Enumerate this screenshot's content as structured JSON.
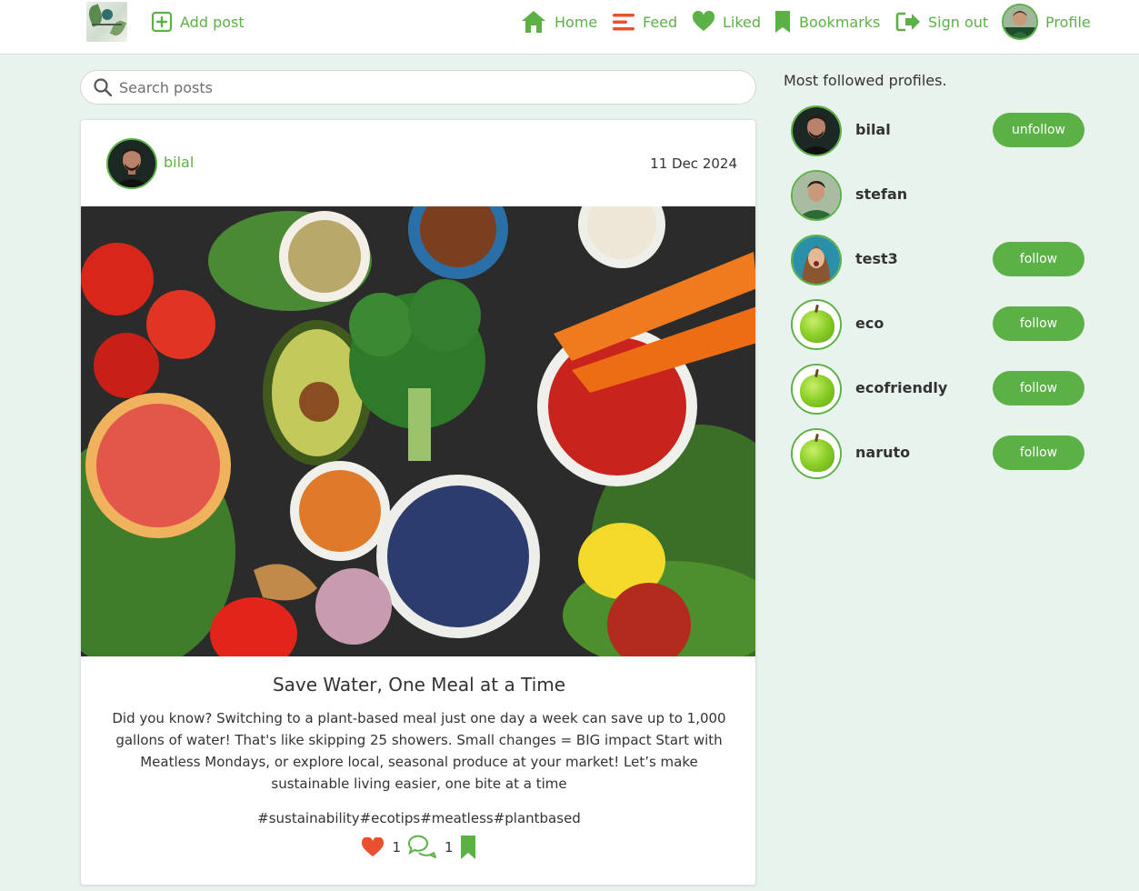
{
  "colors": {
    "accent": "#5cb146",
    "background": "#e9f3ee",
    "heart": "#e8502e"
  },
  "nav": {
    "add_post": "Add post",
    "home": "Home",
    "feed": "Feed",
    "liked": "Liked",
    "bookmarks": "Bookmarks",
    "sign_out": "Sign out",
    "profile": "Profile"
  },
  "search": {
    "placeholder": "Search posts",
    "value": ""
  },
  "post": {
    "author": "bilal",
    "date": "11 Dec 2024",
    "title": "Save Water, One Meal at a Time",
    "body": "Did you know? Switching to a plant-based meal just one day a week can save up to 1,000 gallons of water! That's like skipping 25 showers. Small changes = BIG impact Start with Meatless Mondays, or explore local, seasonal produce at your market! Let’s make sustainable living easier, one bite at a time",
    "tags": "#sustainability#ecotips#meatless#plantbased",
    "likes": "1",
    "comments": "1"
  },
  "sidebar": {
    "title": "Most followed profiles.",
    "profiles": [
      {
        "name": "bilal",
        "button": "unfollow"
      },
      {
        "name": "stefan",
        "button": ""
      },
      {
        "name": "test3",
        "button": "follow"
      },
      {
        "name": "eco",
        "button": "follow"
      },
      {
        "name": "ecofriendly",
        "button": "follow"
      },
      {
        "name": "naruto",
        "button": "follow"
      }
    ]
  }
}
